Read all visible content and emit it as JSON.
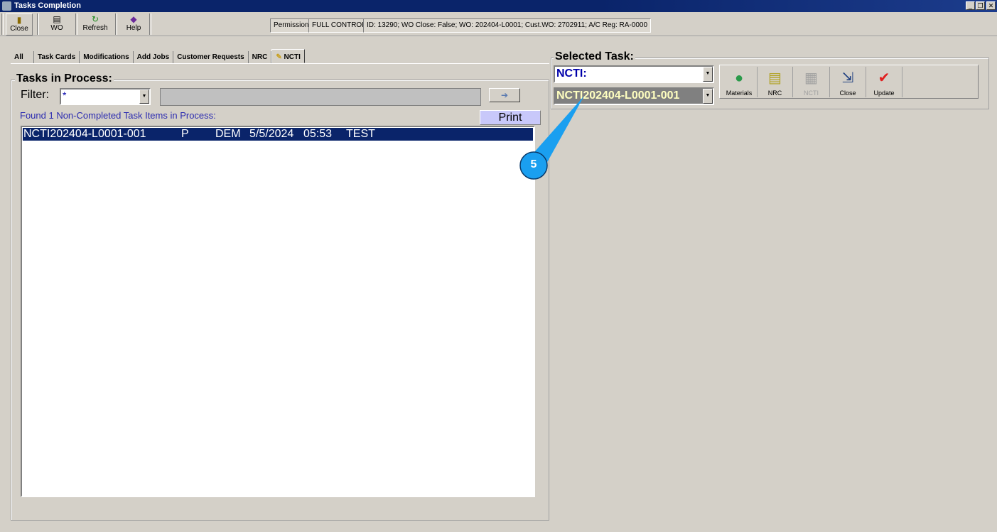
{
  "window": {
    "title": "Tasks Completion"
  },
  "toolbar": {
    "close": "Close",
    "wo": "WO",
    "refresh": "Refresh",
    "help": "Help",
    "permission_label": "Permission:",
    "permission_value": "FULL CONTROL",
    "info": "ID: 13290; WO Close: False; WO: 202404-L0001; Cust.WO: 2702911; A/C Reg: RA-0000"
  },
  "tabs": [
    "All",
    "Task Cards",
    "Modifications",
    "Add Jobs",
    "Customer Requests",
    "NRC",
    "NCTI"
  ],
  "left": {
    "title": "Tasks in Process:",
    "filter_label": "Filter:",
    "filter_value": "*",
    "found": "Found 1 Non-Completed Task Items in Process:",
    "print": "Print",
    "rows": [
      {
        "id": "NCTI202404-L0001-001",
        "status": "P",
        "user": "DEM",
        "date": "5/5/2024",
        "time": "05:53",
        "note": "TEST"
      }
    ]
  },
  "right": {
    "title": "Selected Task:",
    "type_value": "NCTI:",
    "task_value": "NCTI202404-L0001-001",
    "buttons": {
      "materials": "Materials",
      "nrc": "NRC",
      "ncti": "NCTI",
      "close": "Close",
      "update": "Update"
    }
  },
  "annotation": {
    "number": "5",
    "color": "#1a9ff0"
  }
}
